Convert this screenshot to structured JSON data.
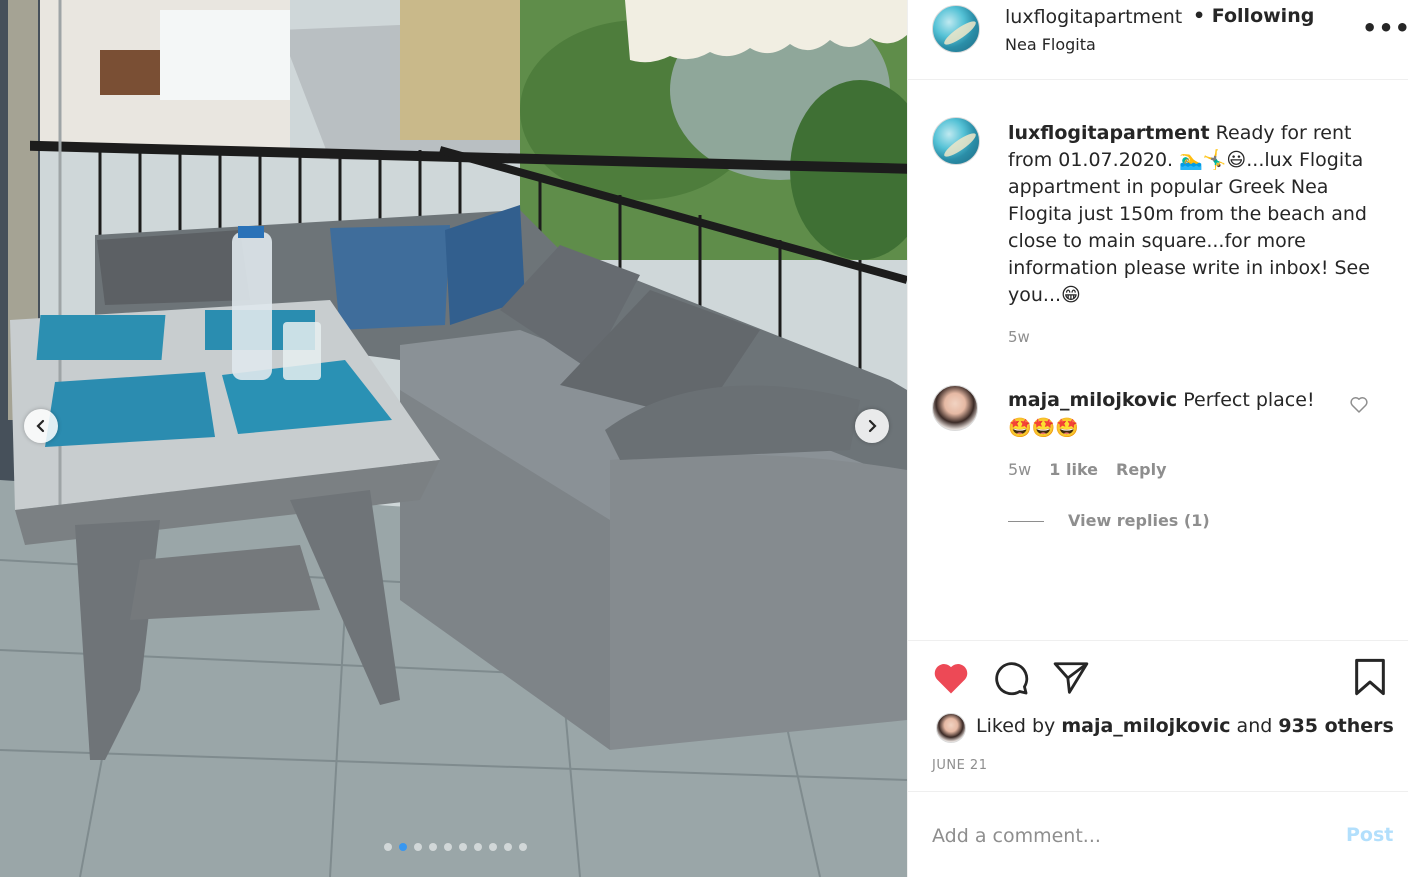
{
  "post": {
    "username": "luxflogitapartment",
    "separator": "•",
    "follow_status": "Following",
    "location": "Nea Flogita",
    "more_icon": "more-options-icon"
  },
  "caption": {
    "username": "luxflogitapartment",
    "text": " Ready for rent from 01.07.2020. 🏊‍♂️🤸‍♂️😃...lux Flogita appartment in popular Greek Nea Flogita just 150m from the beach and close to main square...for more information please write in inbox! See you...😁",
    "time": "5w"
  },
  "comments": [
    {
      "username": "maja_milojkovic",
      "text": " Perfect place!🤩🤩🤩",
      "time": "5w",
      "likes": "1 like",
      "reply_label": "Reply",
      "view_replies": "View replies (1)"
    }
  ],
  "likes": {
    "prefix": "Liked by ",
    "user": "maja_milojkovic",
    "middle": " and ",
    "others": "935 others"
  },
  "date": "JUNE 21",
  "comment_box": {
    "placeholder": "Add a comment...",
    "post_label": "Post"
  },
  "carousel": {
    "total_images": 10,
    "active_index": 1
  },
  "colors": {
    "like_red": "#ed4956",
    "link_blue": "#3897f0",
    "post_disabled": "#b2dffc",
    "muted": "#8e8e8e"
  }
}
